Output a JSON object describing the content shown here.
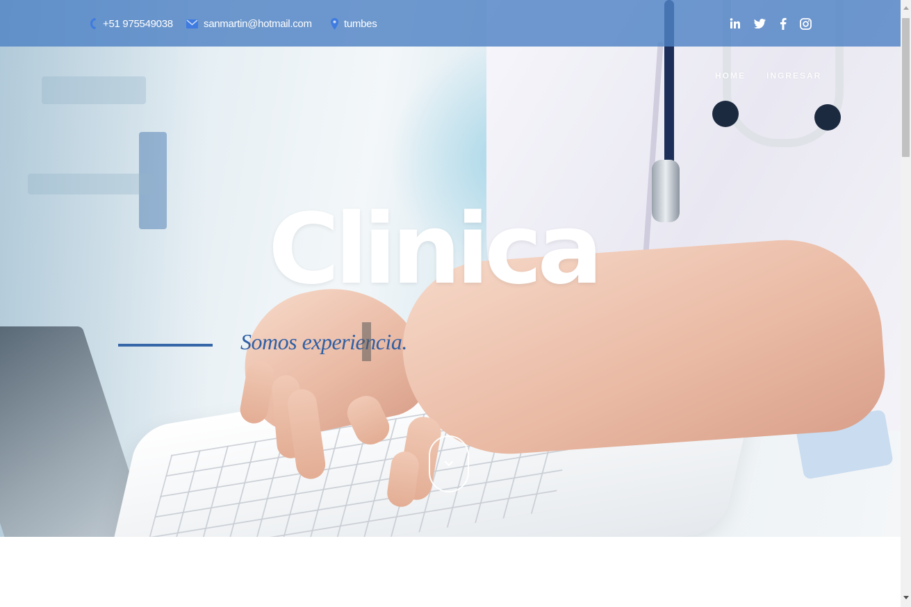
{
  "topbar": {
    "phone": "+51 975549038",
    "email": "sanmartin@hotmail.com",
    "location": "tumbes",
    "icons": [
      "phone-icon",
      "mail-icon",
      "map-pin-icon"
    ],
    "social": [
      "linkedin-icon",
      "twitter-icon",
      "facebook-icon",
      "instagram-icon"
    ],
    "background": "#4f83c4"
  },
  "nav": {
    "home": "HOME",
    "login": "INGRESAR"
  },
  "hero": {
    "title": "Clinica",
    "tagline": "Somos experiencia.",
    "accent": "#2f5fa5",
    "scroll_icon": "chevron-down-icon"
  }
}
